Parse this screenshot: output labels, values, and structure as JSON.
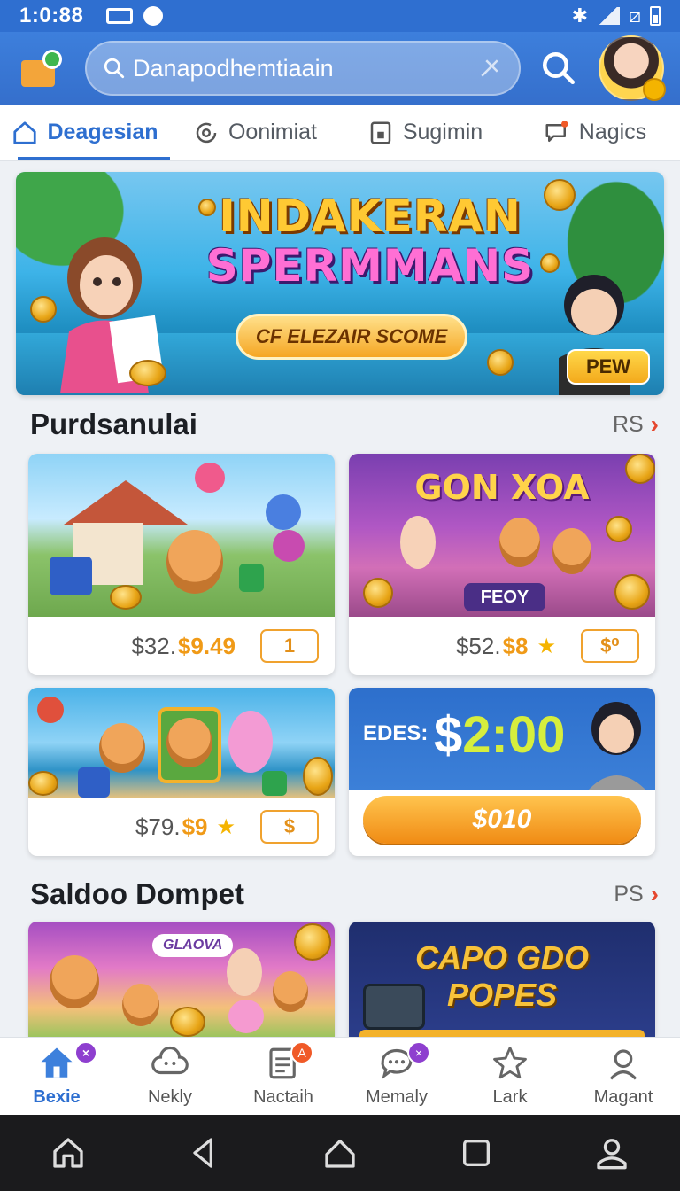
{
  "status_bar": {
    "time": "1:0:88"
  },
  "header": {
    "search_placeholder": "Danapodhemtiaain"
  },
  "tabs": [
    {
      "label": "Deagesian",
      "icon": "home-icon",
      "active": true
    },
    {
      "label": "Oonimiat",
      "icon": "coin-refresh-icon",
      "active": false
    },
    {
      "label": "Sugimin",
      "icon": "document-icon",
      "active": false
    },
    {
      "label": "Nagics",
      "icon": "chat-bubble-icon",
      "active": false
    }
  ],
  "banner": {
    "title_line1": "INDAKERAN",
    "title_line2": "SPERMMANS",
    "cta": "CF ELEZAIR SCOME",
    "badge": "PEW"
  },
  "section1": {
    "title": "Purdsanulai",
    "see_all": "RS"
  },
  "cards": [
    {
      "price_old": "$32.",
      "price_new": "$9.49",
      "chip": "1",
      "star": false
    },
    {
      "title": "GON XOA",
      "overlay_label": "FEOY",
      "price_old": "$52.",
      "price_new": "$8",
      "chip": "$⁰",
      "star": true
    },
    {
      "price_old": "$79.",
      "price_new": "$9",
      "chip": "$",
      "star": true
    }
  ],
  "promo_card": {
    "label": "EDES:",
    "amount_prefix": "$",
    "amount": "2:00",
    "button": "$010"
  },
  "section2": {
    "title": "Saldoo Dompet",
    "see_all": "PS"
  },
  "section2_cards": [
    {
      "badge": "GLAOVA"
    },
    {
      "title_line1": "CAPO GDO",
      "title_line2": "POPES"
    }
  ],
  "bottom_nav": [
    {
      "label": "Bexie",
      "icon": "home-icon",
      "active": true,
      "badge": "×"
    },
    {
      "label": "Nekly",
      "icon": "cloud-face-icon",
      "active": false
    },
    {
      "label": "Nactaih",
      "icon": "notepad-icon",
      "active": false,
      "badge": "A"
    },
    {
      "label": "Memaly",
      "icon": "chat-icon",
      "active": false,
      "badge": "×"
    },
    {
      "label": "Lark",
      "icon": "star-icon",
      "active": false
    },
    {
      "label": "Magant",
      "icon": "profile-icon",
      "active": false
    }
  ],
  "colors": {
    "primary": "#2e6fd0",
    "accent_orange": "#f09a17",
    "badge_purple": "#8e3fcf"
  }
}
